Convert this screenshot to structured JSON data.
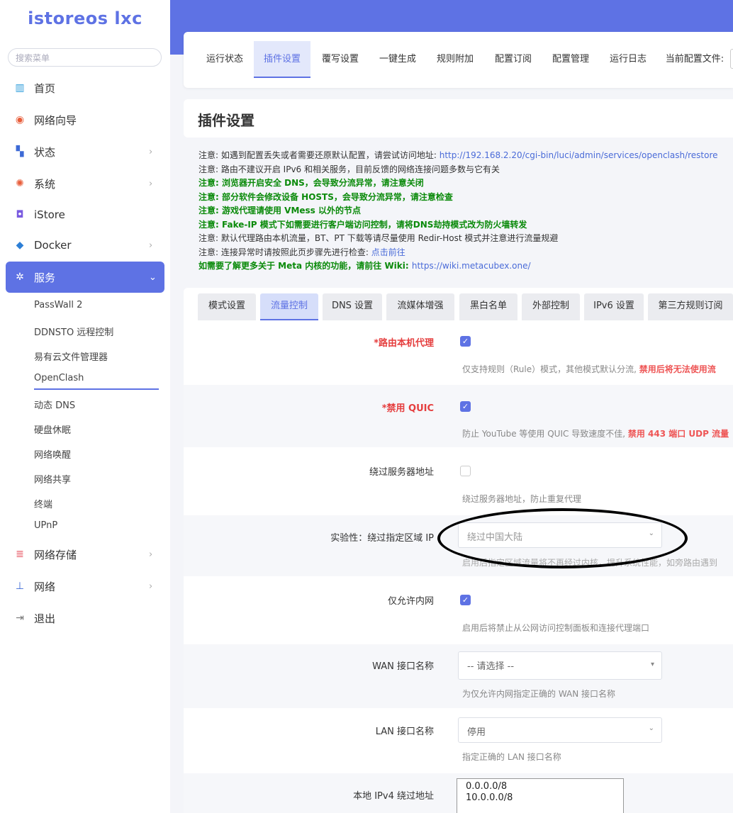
{
  "app": {
    "logo": "istoreos lxc"
  },
  "sidebar": {
    "search_placeholder": "搜索菜单",
    "items": [
      {
        "label": "首页",
        "icon": "dashboard-icon"
      },
      {
        "label": "网络向导",
        "icon": "compass-icon"
      },
      {
        "label": "状态",
        "icon": "grid-icon"
      },
      {
        "label": "系统",
        "icon": "gear-icon"
      },
      {
        "label": "iStore",
        "icon": "store-icon"
      },
      {
        "label": "Docker",
        "icon": "docker-icon"
      },
      {
        "label": "服务",
        "icon": "services-icon"
      },
      {
        "label": "网络存储",
        "icon": "storage-icon"
      },
      {
        "label": "网络",
        "icon": "network-icon"
      },
      {
        "label": "退出",
        "icon": "logout-icon"
      }
    ],
    "sub_items": [
      "PassWall 2",
      "DDNSTO 远程控制",
      "易有云文件管理器",
      "OpenClash",
      "动态 DNS",
      "硬盘休眠",
      "网络唤醒",
      "网络共享",
      "终端",
      "UPnP"
    ]
  },
  "top_tabs": [
    "运行状态",
    "插件设置",
    "覆写设置",
    "一键生成",
    "规则附加",
    "配置订阅",
    "配置管理",
    "运行日志",
    "当前配置文件:"
  ],
  "page_title": "插件设置",
  "notices": [
    {
      "text": "注意: 如遇到配置丢失或者需要还原默认配置，请尝试访问地址: ",
      "link": "http://192.168.2.20/cgi-bin/luci/admin/services/openclash/restore"
    },
    {
      "text": "注意: 路由不建议开启 IPv6 和相关服务，目前反馈的网络连接问题多数与它有关"
    },
    {
      "text": "注意: 浏览器开启安全 DNS，会导致分流异常，请注意关闭"
    },
    {
      "text": "注意: 部分软件会修改设备 HOSTS，会导致分流异常，请注意检查"
    },
    {
      "text": "注意: 游戏代理请使用 VMess 以外的节点"
    },
    {
      "text": "注意: Fake-IP 模式下如需要进行客户端访问控制，请将DNS劫持模式改为防火墙转发"
    },
    {
      "text": "注意: 默认代理路由本机流量，BT、PT 下载等请尽量使用 Redir-Host 模式并注意进行流量规避"
    },
    {
      "text": "注意: 连接异常时请按照此页步骤先进行检查: ",
      "link": "点击前往"
    },
    {
      "text": "如需要了解更多关于 Meta 内核的功能，请前往 Wiki: ",
      "link": "https://wiki.metacubex.one/"
    }
  ],
  "sub_tabs": [
    "模式设置",
    "流量控制",
    "DNS 设置",
    "流媒体增强",
    "黑白名单",
    "外部控制",
    "IPv6 设置",
    "第三方规则订阅"
  ],
  "form": {
    "route_local": {
      "label": "*路由本机代理",
      "help": "仅支持规则（Rule）模式，其他模式默认分流, ",
      "help_warn": "禁用后将无法使用流"
    },
    "disable_quic": {
      "label": "*禁用 QUIC",
      "help": "防止 YouTube 等使用 QUIC 导致速度不佳, ",
      "help_warn": "禁用 443 端口 UDP 流量"
    },
    "bypass_server": {
      "label": "绕过服务器地址",
      "help": "绕过服务器地址，防止重复代理"
    },
    "bypass_region": {
      "label": "实验性：绕过指定区域 IP",
      "value": "绕过中国大陆",
      "help": "启用后指定区域流量将不再经过内核，提升系统性能，如旁路由遇到"
    },
    "lan_only": {
      "label": "仅允许内网",
      "help": "启用后将禁止从公网访问控制面板和连接代理端口"
    },
    "wan_iface": {
      "label": "WAN 接口名称",
      "value": "-- 请选择 --",
      "help": "为仅允许内网指定正确的 WAN 接口名称"
    },
    "lan_iface": {
      "label": "LAN 接口名称",
      "value": "停用",
      "help": "指定正确的 LAN 接口名称"
    },
    "ipv4_bypass": {
      "label": "本地 IPv4 绕过地址",
      "line1": "0.0.0.0/8",
      "line2": "10.0.0.0/8"
    }
  },
  "colors": {
    "accent": "#5e72e4",
    "warning": "#e53e3e",
    "notice_green": "#0a8a0a"
  }
}
